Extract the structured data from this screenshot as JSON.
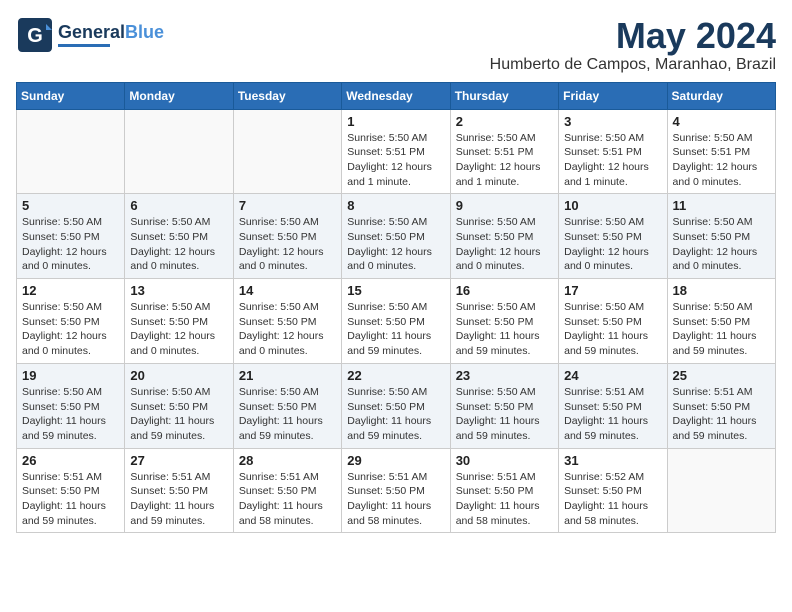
{
  "header": {
    "logo_general": "General",
    "logo_blue": "Blue",
    "month_title": "May 2024",
    "location": "Humberto de Campos, Maranhao, Brazil"
  },
  "days_of_week": [
    "Sunday",
    "Monday",
    "Tuesday",
    "Wednesday",
    "Thursday",
    "Friday",
    "Saturday"
  ],
  "weeks": [
    [
      {
        "day": "",
        "info": ""
      },
      {
        "day": "",
        "info": ""
      },
      {
        "day": "",
        "info": ""
      },
      {
        "day": "1",
        "info": "Sunrise: 5:50 AM\nSunset: 5:51 PM\nDaylight: 12 hours\nand 1 minute."
      },
      {
        "day": "2",
        "info": "Sunrise: 5:50 AM\nSunset: 5:51 PM\nDaylight: 12 hours\nand 1 minute."
      },
      {
        "day": "3",
        "info": "Sunrise: 5:50 AM\nSunset: 5:51 PM\nDaylight: 12 hours\nand 1 minute."
      },
      {
        "day": "4",
        "info": "Sunrise: 5:50 AM\nSunset: 5:51 PM\nDaylight: 12 hours\nand 0 minutes."
      }
    ],
    [
      {
        "day": "5",
        "info": "Sunrise: 5:50 AM\nSunset: 5:50 PM\nDaylight: 12 hours\nand 0 minutes."
      },
      {
        "day": "6",
        "info": "Sunrise: 5:50 AM\nSunset: 5:50 PM\nDaylight: 12 hours\nand 0 minutes."
      },
      {
        "day": "7",
        "info": "Sunrise: 5:50 AM\nSunset: 5:50 PM\nDaylight: 12 hours\nand 0 minutes."
      },
      {
        "day": "8",
        "info": "Sunrise: 5:50 AM\nSunset: 5:50 PM\nDaylight: 12 hours\nand 0 minutes."
      },
      {
        "day": "9",
        "info": "Sunrise: 5:50 AM\nSunset: 5:50 PM\nDaylight: 12 hours\nand 0 minutes."
      },
      {
        "day": "10",
        "info": "Sunrise: 5:50 AM\nSunset: 5:50 PM\nDaylight: 12 hours\nand 0 minutes."
      },
      {
        "day": "11",
        "info": "Sunrise: 5:50 AM\nSunset: 5:50 PM\nDaylight: 12 hours\nand 0 minutes."
      }
    ],
    [
      {
        "day": "12",
        "info": "Sunrise: 5:50 AM\nSunset: 5:50 PM\nDaylight: 12 hours\nand 0 minutes."
      },
      {
        "day": "13",
        "info": "Sunrise: 5:50 AM\nSunset: 5:50 PM\nDaylight: 12 hours\nand 0 minutes."
      },
      {
        "day": "14",
        "info": "Sunrise: 5:50 AM\nSunset: 5:50 PM\nDaylight: 12 hours\nand 0 minutes."
      },
      {
        "day": "15",
        "info": "Sunrise: 5:50 AM\nSunset: 5:50 PM\nDaylight: 11 hours\nand 59 minutes."
      },
      {
        "day": "16",
        "info": "Sunrise: 5:50 AM\nSunset: 5:50 PM\nDaylight: 11 hours\nand 59 minutes."
      },
      {
        "day": "17",
        "info": "Sunrise: 5:50 AM\nSunset: 5:50 PM\nDaylight: 11 hours\nand 59 minutes."
      },
      {
        "day": "18",
        "info": "Sunrise: 5:50 AM\nSunset: 5:50 PM\nDaylight: 11 hours\nand 59 minutes."
      }
    ],
    [
      {
        "day": "19",
        "info": "Sunrise: 5:50 AM\nSunset: 5:50 PM\nDaylight: 11 hours\nand 59 minutes."
      },
      {
        "day": "20",
        "info": "Sunrise: 5:50 AM\nSunset: 5:50 PM\nDaylight: 11 hours\nand 59 minutes."
      },
      {
        "day": "21",
        "info": "Sunrise: 5:50 AM\nSunset: 5:50 PM\nDaylight: 11 hours\nand 59 minutes."
      },
      {
        "day": "22",
        "info": "Sunrise: 5:50 AM\nSunset: 5:50 PM\nDaylight: 11 hours\nand 59 minutes."
      },
      {
        "day": "23",
        "info": "Sunrise: 5:50 AM\nSunset: 5:50 PM\nDaylight: 11 hours\nand 59 minutes."
      },
      {
        "day": "24",
        "info": "Sunrise: 5:51 AM\nSunset: 5:50 PM\nDaylight: 11 hours\nand 59 minutes."
      },
      {
        "day": "25",
        "info": "Sunrise: 5:51 AM\nSunset: 5:50 PM\nDaylight: 11 hours\nand 59 minutes."
      }
    ],
    [
      {
        "day": "26",
        "info": "Sunrise: 5:51 AM\nSunset: 5:50 PM\nDaylight: 11 hours\nand 59 minutes."
      },
      {
        "day": "27",
        "info": "Sunrise: 5:51 AM\nSunset: 5:50 PM\nDaylight: 11 hours\nand 59 minutes."
      },
      {
        "day": "28",
        "info": "Sunrise: 5:51 AM\nSunset: 5:50 PM\nDaylight: 11 hours\nand 58 minutes."
      },
      {
        "day": "29",
        "info": "Sunrise: 5:51 AM\nSunset: 5:50 PM\nDaylight: 11 hours\nand 58 minutes."
      },
      {
        "day": "30",
        "info": "Sunrise: 5:51 AM\nSunset: 5:50 PM\nDaylight: 11 hours\nand 58 minutes."
      },
      {
        "day": "31",
        "info": "Sunrise: 5:52 AM\nSunset: 5:50 PM\nDaylight: 11 hours\nand 58 minutes."
      },
      {
        "day": "",
        "info": ""
      }
    ]
  ]
}
